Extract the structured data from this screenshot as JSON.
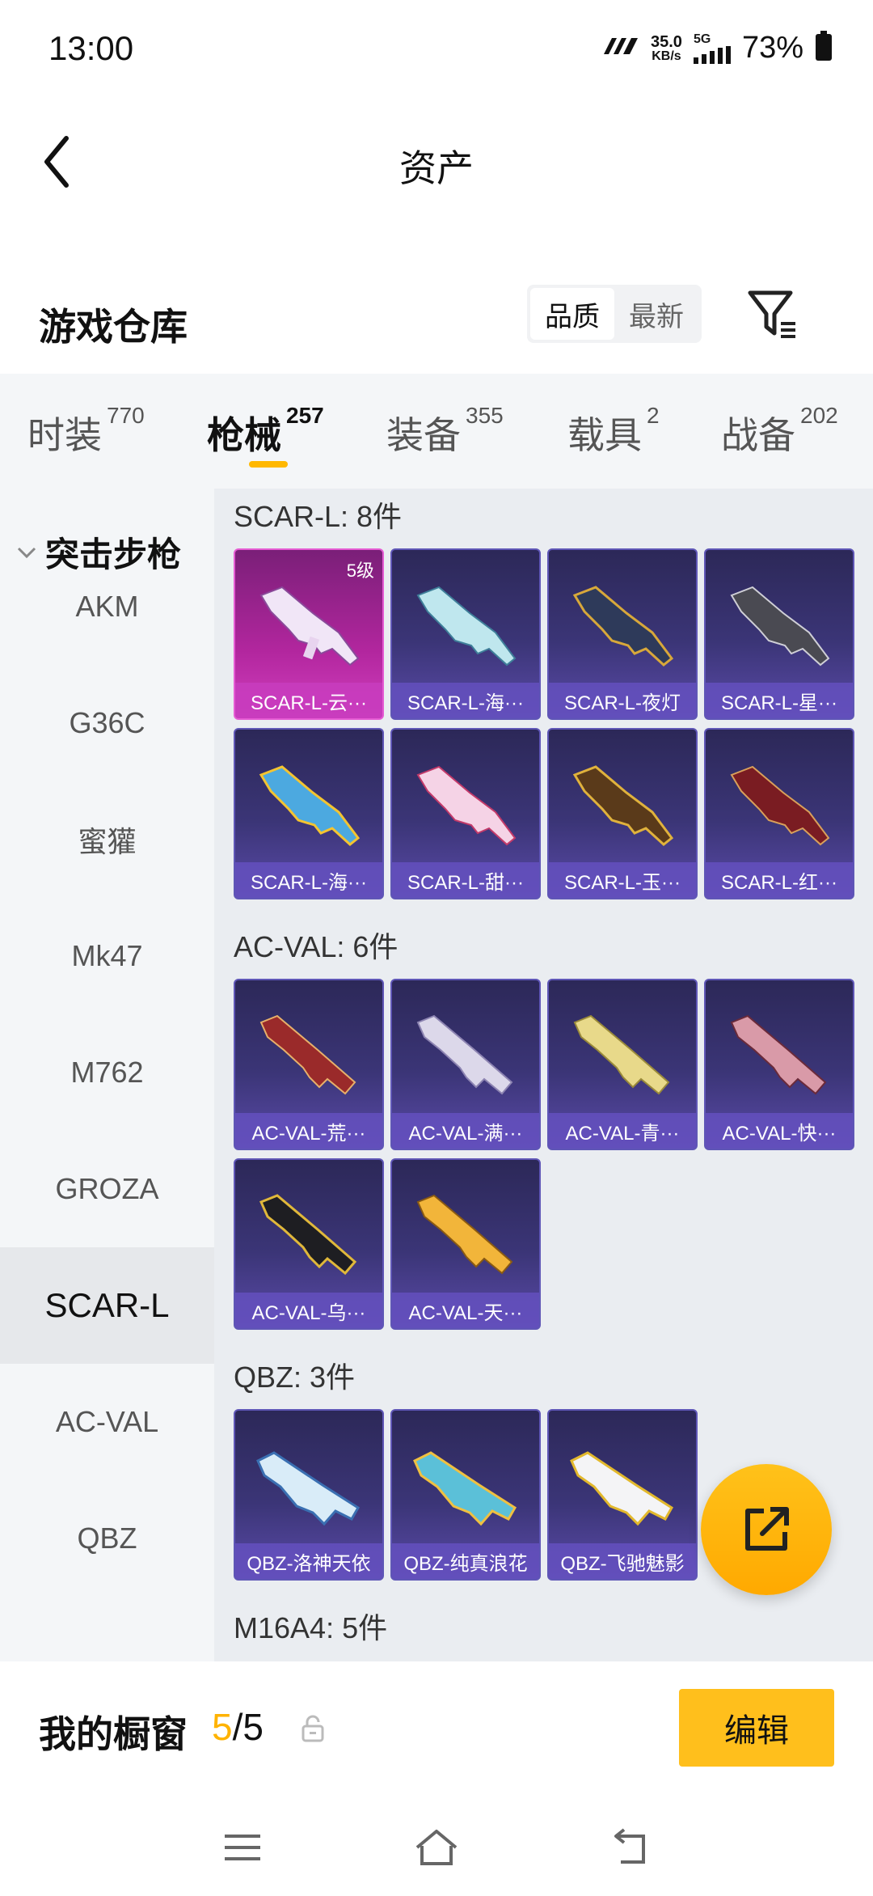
{
  "status_bar": {
    "time": "13:00",
    "speed_value": "35.0",
    "speed_unit": "KB/s",
    "network": "5G",
    "battery": "73%"
  },
  "header": {
    "title": "资产"
  },
  "warehouse": {
    "title": "游戏仓库",
    "sort_options": [
      "品质",
      "最新"
    ],
    "sort_selected": "品质"
  },
  "category_tabs": [
    {
      "label": "时装",
      "count": "770"
    },
    {
      "label": "枪械",
      "count": "257",
      "active": true
    },
    {
      "label": "装备",
      "count": "355"
    },
    {
      "label": "载具",
      "count": "2"
    },
    {
      "label": "战备",
      "count": "202"
    }
  ],
  "sidebar": {
    "section": "突击步枪",
    "items": [
      "AKM",
      "G36C",
      "蜜獾",
      "Mk47",
      "M762",
      "GROZA",
      "SCAR-L",
      "AC-VAL",
      "QBZ"
    ],
    "active": "SCAR-L"
  },
  "groups": [
    {
      "title": "SCAR-L: 8件",
      "items": [
        {
          "label": "SCAR-L-云···",
          "badge": "5级",
          "rarity": "legendary"
        },
        {
          "label": "SCAR-L-海···"
        },
        {
          "label": "SCAR-L-夜灯"
        },
        {
          "label": "SCAR-L-星···"
        },
        {
          "label": "SCAR-L-海···"
        },
        {
          "label": "SCAR-L-甜···"
        },
        {
          "label": "SCAR-L-玉···"
        },
        {
          "label": "SCAR-L-红···"
        }
      ]
    },
    {
      "title": "AC-VAL: 6件",
      "items": [
        {
          "label": "AC-VAL-荒···"
        },
        {
          "label": "AC-VAL-满···"
        },
        {
          "label": "AC-VAL-青···"
        },
        {
          "label": "AC-VAL-快···"
        },
        {
          "label": "AC-VAL-乌···"
        },
        {
          "label": "AC-VAL-天···"
        }
      ]
    },
    {
      "title": "QBZ: 3件",
      "items": [
        {
          "label": "QBZ-洛神天依"
        },
        {
          "label": "QBZ-纯真浪花"
        },
        {
          "label": "QBZ-飞驰魅影"
        }
      ]
    },
    {
      "title": "M16A4: 5件",
      "items": []
    }
  ],
  "showcase": {
    "label": "我的橱窗",
    "current": "5",
    "separator": "/",
    "total": "5",
    "edit_label": "编辑"
  },
  "colors": {
    "accent": "#ffb800",
    "card_bg": "#3b3577",
    "legendary": "#b2269e"
  }
}
